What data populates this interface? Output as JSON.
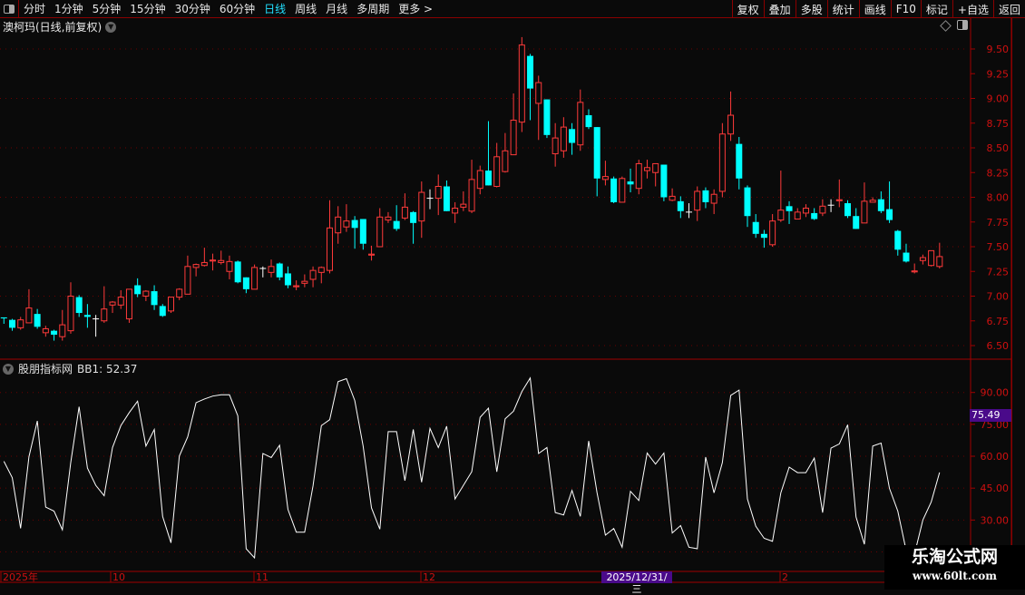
{
  "toolbar": {
    "periods": [
      "分时",
      "1分钟",
      "5分钟",
      "15分钟",
      "30分钟",
      "60分钟",
      "日线",
      "周线",
      "月线",
      "多周期",
      "更多 >"
    ],
    "active_period": "日线",
    "buttons": [
      "复权",
      "叠加",
      "多股",
      "统计",
      "画线",
      "F10",
      "标记",
      "+自选",
      "返回"
    ]
  },
  "main_chart": {
    "title": "澳柯玛(日线,前复权)",
    "price_axis": [
      "9.50",
      "9.25",
      "9.00",
      "8.75",
      "8.50",
      "8.25",
      "8.00",
      "7.75",
      "7.50",
      "7.25",
      "7.00",
      "6.75",
      "6.50"
    ]
  },
  "indicator": {
    "name": "股朋指标网",
    "value_label": "BB1: 52.37",
    "axis": [
      "90.00",
      "75.00",
      "60.00",
      "45.00",
      "30.00"
    ],
    "cursor_value": "75.49"
  },
  "date_axis": {
    "labels": [
      "2025年",
      "10",
      "11",
      "12",
      "2"
    ],
    "cursor_date": "2025/12/31/三"
  },
  "watermark": {
    "line1": "乐淘公式网",
    "line2": "www.60lt.com"
  },
  "colors": {
    "up": "#ff3a3a",
    "down": "#00ffff",
    "flat": "#ffffff",
    "axis": "#d01010",
    "grid": "#6a0000",
    "active": "#22e0ff",
    "line": "#ffffff"
  },
  "chart_data": {
    "type": "candlestick",
    "ylim": [
      6.45,
      9.65
    ],
    "ohlc": [
      [
        6.785,
        6.785,
        6.72,
        6.775
      ],
      [
        6.76,
        6.77,
        6.65,
        6.68
      ],
      [
        6.68,
        6.79,
        6.66,
        6.76
      ],
      [
        6.73,
        7.07,
        6.73,
        6.88
      ],
      [
        6.82,
        6.87,
        6.67,
        6.69
      ],
      [
        6.63,
        6.7,
        6.59,
        6.67
      ],
      [
        6.65,
        6.66,
        6.55,
        6.61
      ],
      [
        6.59,
        6.86,
        6.55,
        6.71
      ],
      [
        6.65,
        7.14,
        6.62,
        7.0
      ],
      [
        6.99,
        7.01,
        6.79,
        6.83
      ],
      [
        6.81,
        6.92,
        6.68,
        6.79
      ],
      [
        6.77,
        6.81,
        6.59,
        6.77
      ],
      [
        6.75,
        7.1,
        6.73,
        6.87
      ],
      [
        6.91,
        6.95,
        6.83,
        6.94
      ],
      [
        6.91,
        7.06,
        6.87,
        6.99
      ],
      [
        6.77,
        7.07,
        6.73,
        7.07
      ],
      [
        7.11,
        7.18,
        6.99,
        7.02
      ],
      [
        7.0,
        7.06,
        6.95,
        7.05
      ],
      [
        7.05,
        7.11,
        6.86,
        6.91
      ],
      [
        6.9,
        6.92,
        6.79,
        6.8
      ],
      [
        6.85,
        6.99,
        6.83,
        6.99
      ],
      [
        6.99,
        7.08,
        6.96,
        7.07
      ],
      [
        7.02,
        7.41,
        7.02,
        7.3
      ],
      [
        7.29,
        7.33,
        7.2,
        7.32
      ],
      [
        7.31,
        7.49,
        7.3,
        7.34
      ],
      [
        7.355,
        7.43,
        7.26,
        7.365
      ],
      [
        7.34,
        7.46,
        7.32,
        7.36
      ],
      [
        7.25,
        7.41,
        7.17,
        7.35
      ],
      [
        7.35,
        7.36,
        7.13,
        7.14
      ],
      [
        7.19,
        7.19,
        7.03,
        7.07
      ],
      [
        7.07,
        7.32,
        7.07,
        7.29
      ],
      [
        7.28,
        7.3,
        7.19,
        7.28
      ],
      [
        7.24,
        7.37,
        7.19,
        7.3
      ],
      [
        7.33,
        7.34,
        7.16,
        7.19
      ],
      [
        7.23,
        7.3,
        7.08,
        7.11
      ],
      [
        7.095,
        7.16,
        7.06,
        7.105
      ],
      [
        7.13,
        7.22,
        7.09,
        7.15
      ],
      [
        7.17,
        7.3,
        7.09,
        7.26
      ],
      [
        7.24,
        7.3,
        7.13,
        7.29
      ],
      [
        7.26,
        7.97,
        7.23,
        7.69
      ],
      [
        7.64,
        7.91,
        7.53,
        7.8
      ],
      [
        7.7,
        7.93,
        7.65,
        7.76
      ],
      [
        7.77,
        7.81,
        7.48,
        7.69
      ],
      [
        7.78,
        7.78,
        7.47,
        7.53
      ],
      [
        7.415,
        7.51,
        7.36,
        7.425
      ],
      [
        7.5,
        7.89,
        7.5,
        7.8
      ],
      [
        7.77,
        7.85,
        7.74,
        7.8
      ],
      [
        7.76,
        7.92,
        7.66,
        7.68
      ],
      [
        7.79,
        8.04,
        7.77,
        7.9
      ],
      [
        7.85,
        7.86,
        7.53,
        7.74
      ],
      [
        7.76,
        8.16,
        7.59,
        8.05
      ],
      [
        7.99,
        8.08,
        7.88,
        7.99
      ],
      [
        7.99,
        8.23,
        7.82,
        8.11
      ],
      [
        8.11,
        8.17,
        7.86,
        7.86
      ],
      [
        7.84,
        7.95,
        7.74,
        7.89
      ],
      [
        7.9,
        8.06,
        7.86,
        7.93
      ],
      [
        7.86,
        8.38,
        7.84,
        8.18
      ],
      [
        8.09,
        8.32,
        8.03,
        8.27
      ],
      [
        8.27,
        8.77,
        8.12,
        8.12
      ],
      [
        8.11,
        8.55,
        8.1,
        8.41
      ],
      [
        8.26,
        8.65,
        8.25,
        8.47
      ],
      [
        8.43,
        9.05,
        8.43,
        8.78
      ],
      [
        8.76,
        9.62,
        8.66,
        9.54
      ],
      [
        9.43,
        9.45,
        8.78,
        9.1
      ],
      [
        8.95,
        9.23,
        8.58,
        9.16
      ],
      [
        8.99,
        8.99,
        8.6,
        8.63
      ],
      [
        8.44,
        8.75,
        8.31,
        8.6
      ],
      [
        8.47,
        8.81,
        8.4,
        8.71
      ],
      [
        8.69,
        8.75,
        8.43,
        8.55
      ],
      [
        8.53,
        9.09,
        8.47,
        8.96
      ],
      [
        8.83,
        8.89,
        8.69,
        8.71
      ],
      [
        8.71,
        8.71,
        8.01,
        8.19
      ],
      [
        8.18,
        8.37,
        8.12,
        8.21
      ],
      [
        8.19,
        8.21,
        7.94,
        7.95
      ],
      [
        7.95,
        8.21,
        7.95,
        8.19
      ],
      [
        8.16,
        8.29,
        8.05,
        8.13
      ],
      [
        8.09,
        8.38,
        8.03,
        8.34
      ],
      [
        8.27,
        8.38,
        8.19,
        8.3
      ],
      [
        8.25,
        8.34,
        8.11,
        8.34
      ],
      [
        8.33,
        8.33,
        7.96,
        8.0
      ],
      [
        7.97,
        8.09,
        7.96,
        8.01
      ],
      [
        7.96,
        8.01,
        7.79,
        7.86
      ],
      [
        7.85,
        7.94,
        7.79,
        7.85
      ],
      [
        7.87,
        8.11,
        7.76,
        8.06
      ],
      [
        8.07,
        8.1,
        7.89,
        7.95
      ],
      [
        7.94,
        8.08,
        7.83,
        8.03
      ],
      [
        8.06,
        8.75,
        8.0,
        8.64
      ],
      [
        8.64,
        9.07,
        8.57,
        8.83
      ],
      [
        8.54,
        8.61,
        8.08,
        8.19
      ],
      [
        8.1,
        8.12,
        7.7,
        7.81
      ],
      [
        7.75,
        7.83,
        7.59,
        7.63
      ],
      [
        7.63,
        7.67,
        7.49,
        7.59
      ],
      [
        7.52,
        7.83,
        7.5,
        7.76
      ],
      [
        7.77,
        8.27,
        7.75,
        7.87
      ],
      [
        7.91,
        7.96,
        7.73,
        7.86
      ],
      [
        7.78,
        7.89,
        7.78,
        7.85
      ],
      [
        7.84,
        7.93,
        7.8,
        7.89
      ],
      [
        7.84,
        7.89,
        7.77,
        7.78
      ],
      [
        7.84,
        7.98,
        7.81,
        7.91
      ],
      [
        7.92,
        7.98,
        7.85,
        7.92
      ],
      [
        7.965,
        8.18,
        7.9,
        7.975
      ],
      [
        7.94,
        7.97,
        7.79,
        7.81
      ],
      [
        7.81,
        7.89,
        7.68,
        7.68
      ],
      [
        7.74,
        8.15,
        7.74,
        7.96
      ],
      [
        7.95,
        8.0,
        7.95,
        7.97
      ],
      [
        7.98,
        8.06,
        7.84,
        7.86
      ],
      [
        7.88,
        8.16,
        7.74,
        7.77
      ],
      [
        7.66,
        7.67,
        7.41,
        7.47
      ],
      [
        7.44,
        7.53,
        7.34,
        7.35
      ],
      [
        7.245,
        7.33,
        7.23,
        7.255
      ],
      [
        7.36,
        7.42,
        7.32,
        7.39
      ],
      [
        7.31,
        7.46,
        7.3,
        7.46
      ],
      [
        7.3,
        7.54,
        7.28,
        7.4
      ]
    ],
    "indicator_series": {
      "name": "BB1",
      "ylim": [
        8,
        100
      ],
      "values": [
        57.6,
        49.9,
        26.1,
        59.8,
        76.6,
        36.1,
        34.2,
        25.4,
        57.0,
        83.3,
        54.4,
        46.3,
        41.4,
        64.1,
        74.4,
        80.5,
        85.9,
        64.8,
        72.6,
        31.7,
        19.3,
        60.1,
        69.1,
        85.2,
        86.9,
        88.3,
        88.9,
        88.9,
        79.0,
        16.5,
        12.2,
        61.3,
        59.4,
        65.2,
        35.0,
        24.3,
        24.3,
        46.0,
        74.4,
        77.2,
        95.1,
        96.5,
        86.2,
        64.8,
        35.7,
        25.7,
        71.6,
        71.6,
        48.5,
        72.6,
        47.8,
        73.1,
        64.1,
        74.1,
        39.9,
        46.3,
        52.7,
        78.3,
        82.6,
        52.7,
        77.6,
        81.2,
        90.4,
        96.8,
        61.3,
        64.1,
        33.5,
        32.4,
        43.9,
        31.7,
        67.2,
        42.8,
        22.9,
        26.0,
        17.2,
        43.5,
        39.2,
        61.5,
        56.3,
        61.5,
        23.9,
        27.4,
        17.2,
        16.5,
        59.6,
        42.8,
        57.0,
        88.6,
        91.1,
        39.9,
        27.1,
        21.4,
        20.0,
        42.8,
        54.9,
        52.3,
        52.3,
        59.1,
        33.5,
        63.8,
        65.8,
        74.8,
        31.4,
        18.6,
        64.8,
        66.2,
        44.9,
        34.2,
        15.7,
        14.0,
        30.0,
        38.5,
        52.37
      ]
    }
  }
}
